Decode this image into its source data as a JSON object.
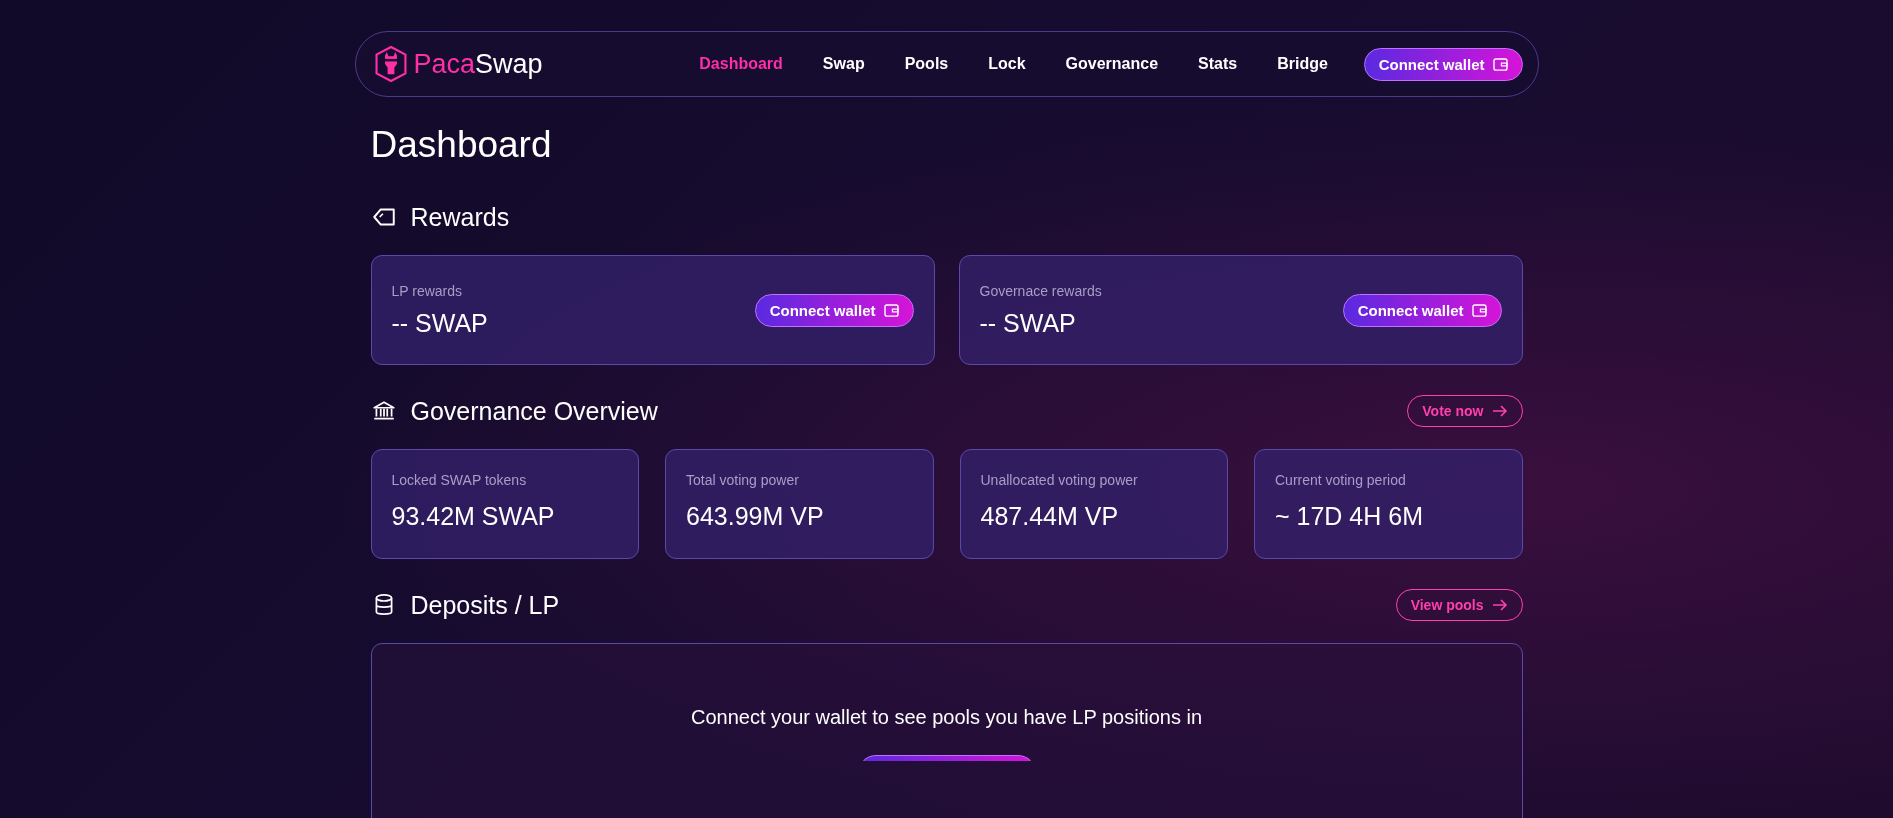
{
  "brand": {
    "part1": "Paca",
    "part2": "Swap"
  },
  "nav": [
    {
      "label": "Dashboard",
      "selected": true
    },
    {
      "label": "Swap",
      "selected": false
    },
    {
      "label": "Pools",
      "selected": false
    },
    {
      "label": "Lock",
      "selected": false
    },
    {
      "label": "Governance",
      "selected": false
    },
    {
      "label": "Stats",
      "selected": false
    },
    {
      "label": "Bridge",
      "selected": false
    }
  ],
  "header_button": "Connect wallet",
  "page_title": "Dashboard",
  "rewards": {
    "title": "Rewards",
    "cards": [
      {
        "label": "LP rewards",
        "value": "-- SWAP",
        "button": "Connect wallet"
      },
      {
        "label": "Governace rewards",
        "value": "-- SWAP",
        "button": "Connect wallet"
      }
    ]
  },
  "governance": {
    "title": "Governance Overview",
    "link": "Vote now",
    "stats": [
      {
        "label": "Locked SWAP tokens",
        "value": "93.42M SWAP"
      },
      {
        "label": "Total voting power",
        "value": "643.99M VP"
      },
      {
        "label": "Unallocated voting power",
        "value": "487.44M VP"
      },
      {
        "label": "Current voting period",
        "value": "~ 17D 4H 6M"
      }
    ]
  },
  "deposits": {
    "title": "Deposits / LP",
    "link": "View pools",
    "message": "Connect your wallet to see pools you have LP positions in"
  }
}
